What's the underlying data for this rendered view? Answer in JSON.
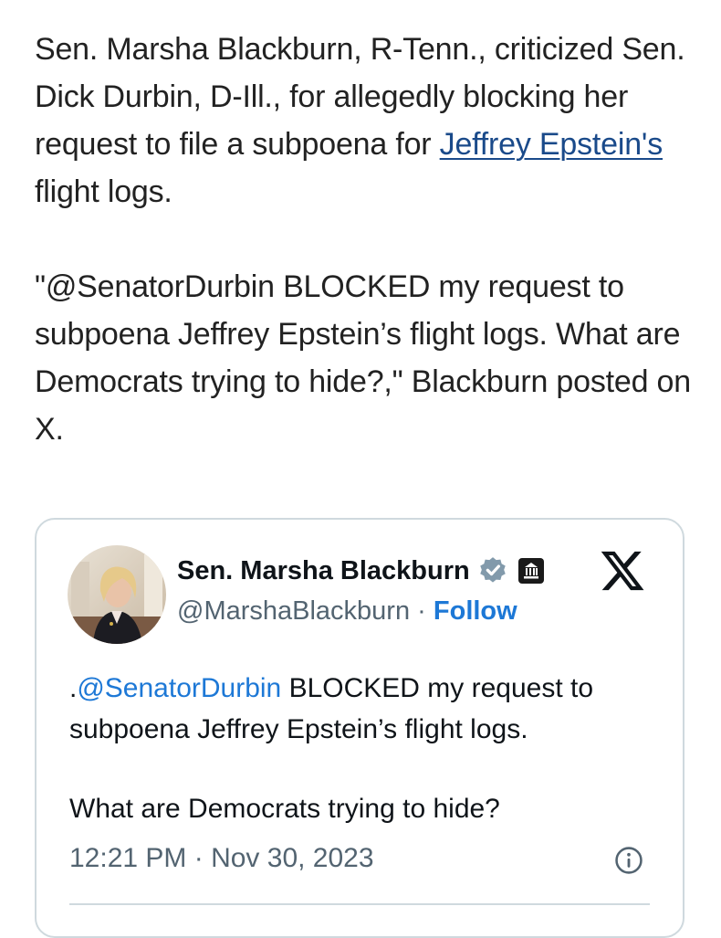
{
  "article": {
    "para1_before_link": "Sen. Marsha Blackburn, R-Tenn., criticized Sen. Dick Durbin, D-Ill., for allegedly blocking her request to file a subpoena for ",
    "para1_link": "Jeffrey Epstein's",
    "para1_after_link": " flight logs.",
    "para2": "\"@SenatorDurbin BLOCKED my request to subpoena Jeffrey Epstein’s flight logs. What are Democrats trying to hide?,\" Blackburn posted on X."
  },
  "tweet": {
    "author_name": "Sen. Marsha Blackburn",
    "handle": "@MarshaBlackburn",
    "separator": " · ",
    "follow_label": "Follow",
    "body_prefix": ".",
    "mention": "@SenatorDurbin",
    "body_line1_rest": " BLOCKED my request to subpoena Jeffrey Epstein’s flight logs.",
    "body_line2": "What are Democrats trying to hide?",
    "timestamp": "12:21 PM · Nov 30, 2023",
    "icons": {
      "verified": "verified-badge-icon",
      "government": "government-building-icon",
      "platform": "x-logo-icon",
      "info": "info-icon"
    },
    "colors": {
      "link": "#1d78d6",
      "verified": "#829aab",
      "muted": "#536471"
    }
  }
}
